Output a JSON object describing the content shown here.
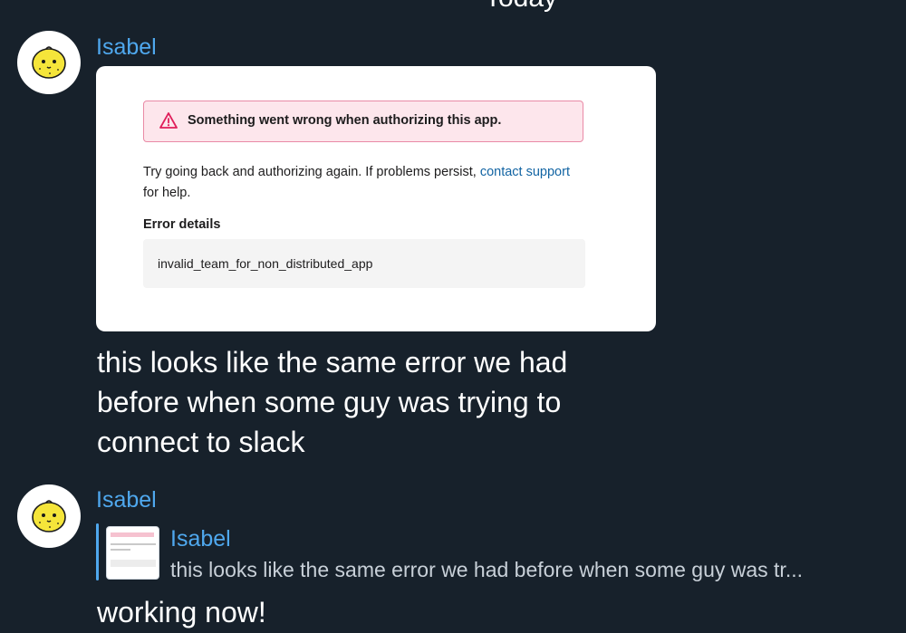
{
  "date_separator": "Today",
  "messages": [
    {
      "sender": "Isabel",
      "avatar_icon": "lemon-face-icon",
      "attachment": {
        "banner_icon": "warning-triangle-icon",
        "banner_text": "Something went wrong when authorizing this app.",
        "body_prefix": "Try going back and authorizing again. If problems persist, ",
        "body_link": "contact support",
        "body_suffix": "for help.",
        "details_title": "Error details",
        "error_code": "invalid_team_for_non_distributed_app"
      },
      "text_lines": [
        "this looks like the same error we had",
        "before when some guy was trying to",
        "connect to slack"
      ]
    },
    {
      "sender": "Isabel",
      "avatar_icon": "lemon-face-icon",
      "reply": {
        "sender": "Isabel",
        "text": "this looks like the same error we had before when some guy was tr..."
      },
      "text": "working now!"
    }
  ],
  "colors": {
    "background": "#17212b",
    "sender_name": "#4fa8ee",
    "error_accent": "#e01e5a",
    "link": "#1264a3"
  }
}
